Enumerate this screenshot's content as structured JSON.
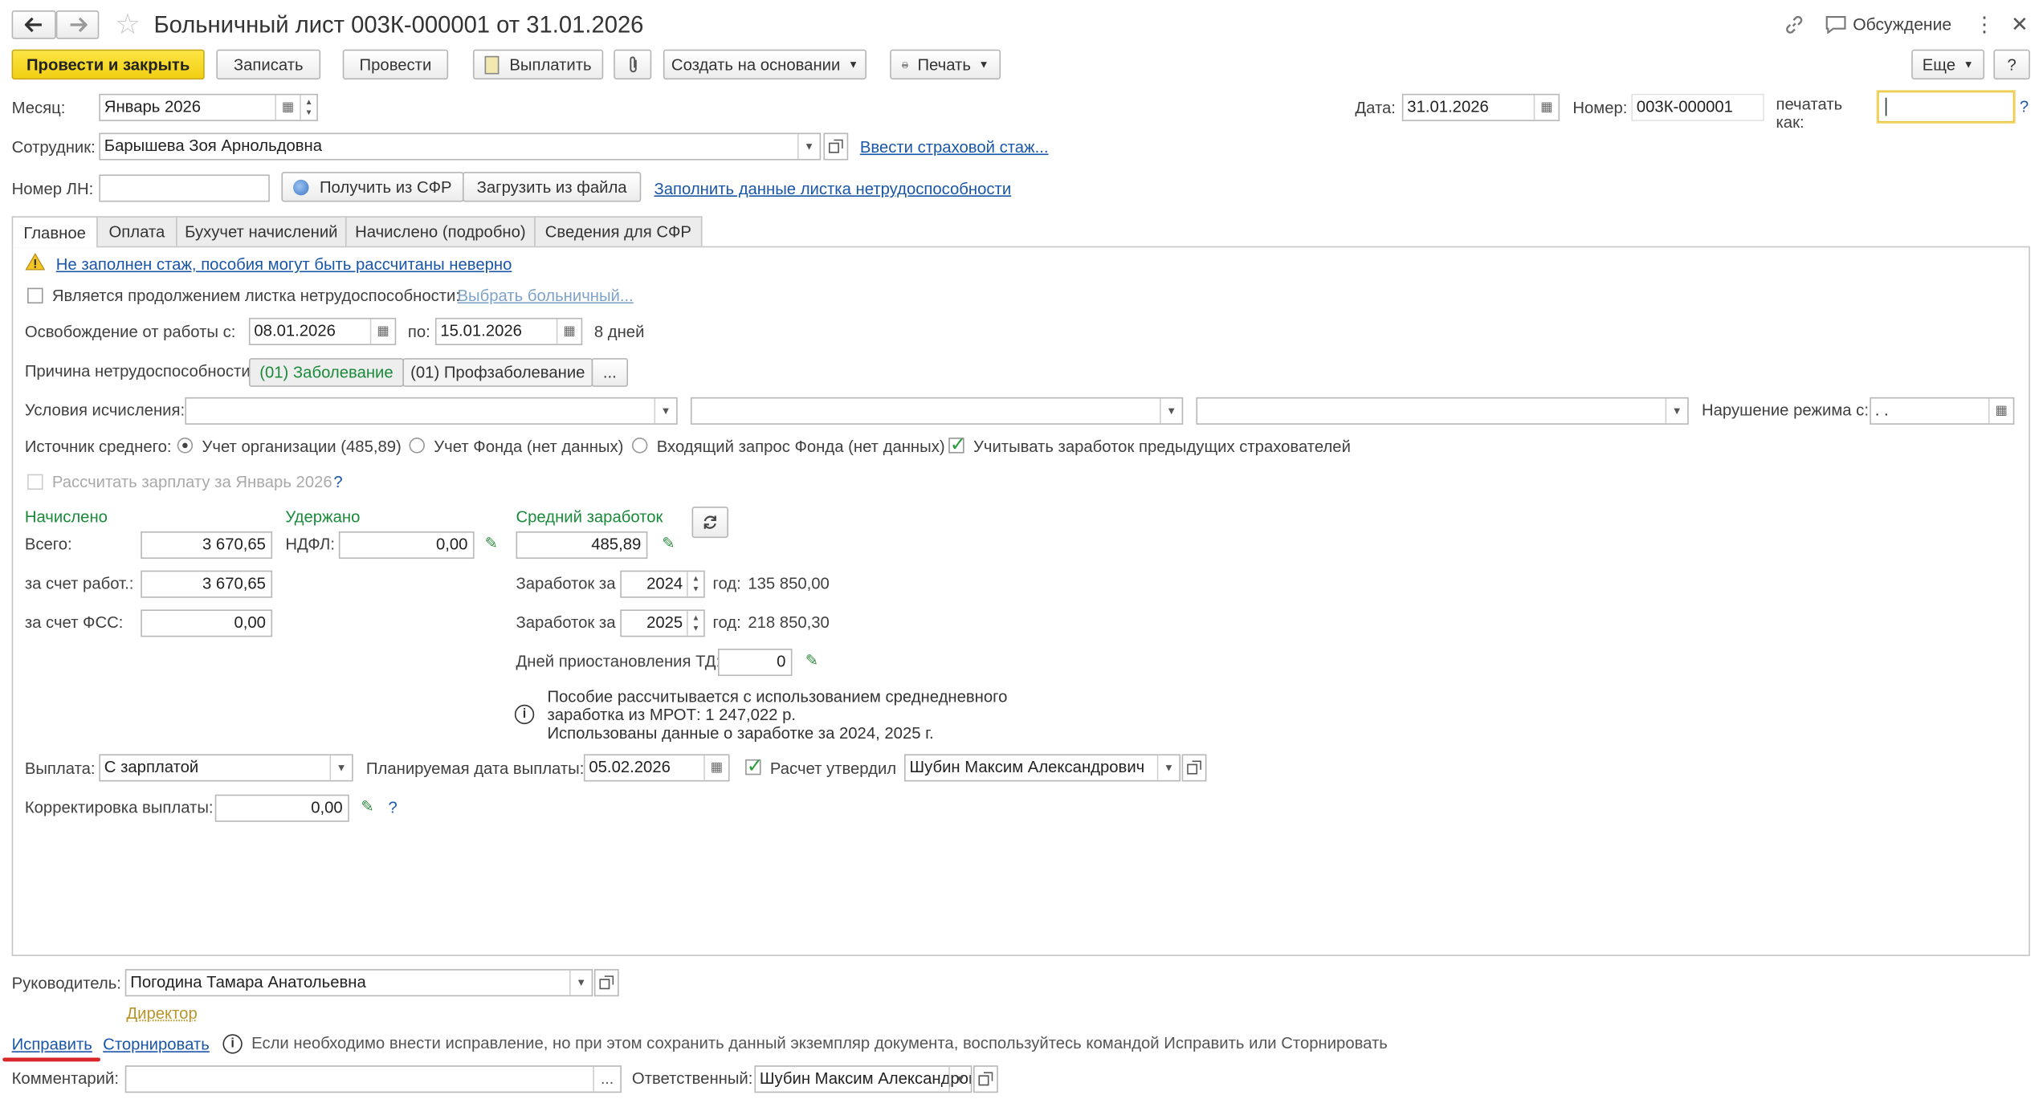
{
  "window": {
    "title": "Больничный лист 003К-000001 от 31.01.2026",
    "discussion": "Обсуждение"
  },
  "toolbar": {
    "post_close": "Провести и закрыть",
    "save": "Записать",
    "post": "Провести",
    "pay": "Выплатить",
    "create_based": "Создать на основании",
    "print": "Печать",
    "more": "Еще",
    "help": "?"
  },
  "header": {
    "month_label": "Месяц:",
    "month_value": "Январь 2026",
    "date_label": "Дата:",
    "date_value": "31.01.2026",
    "number_label": "Номер:",
    "number_value": "003К-000001",
    "print_as_label_1": "печатать",
    "print_as_label_2": "как:",
    "print_as_value": "",
    "print_as_help": "?",
    "employee_label": "Сотрудник:",
    "employee_value": "Барышева Зоя Арнольдовна",
    "insurance_link": "Ввести страховой стаж...",
    "ln_label": "Номер ЛН:",
    "ln_value": "",
    "get_sfr": "Получить из СФР",
    "load_file": "Загрузить из файла",
    "fill_link": "Заполнить данные листка нетрудоспособности"
  },
  "tabs": [
    {
      "label": "Главное",
      "active": true
    },
    {
      "label": "Оплата"
    },
    {
      "label": "Бухучет начислений"
    },
    {
      "label": "Начислено (подробно)"
    },
    {
      "label": "Сведения для СФР"
    }
  ],
  "main": {
    "warning_link": "Не заполнен стаж, пособия могут быть рассчитаны неверно",
    "continuation_label": "Является продолжением листка нетрудоспособности:",
    "choose_link": "Выбрать больничный...",
    "release_label": "Освобождение от работы с:",
    "release_from": "08.01.2026",
    "release_to_label": "по:",
    "release_to": "15.01.2026",
    "days": "8 дней",
    "reason_label": "Причина нетрудоспособности:",
    "reason_1": "(01) Заболевание",
    "reason_2": "(01) Профзаболевание",
    "reason_more": "...",
    "conditions_label": "Условия исчисления:",
    "violation_label": "Нарушение режима с:",
    "violation_value": " .  .",
    "avg_source_label": "Источник среднего:",
    "avg_opt_1": "Учет организации (485,89)",
    "avg_opt_2": "Учет Фонда (нет данных)",
    "avg_opt_3": "Входящий запрос Фонда (нет данных)",
    "prev_insurers": "Учитывать заработок предыдущих страхователей",
    "calc_salary": "Рассчитать зарплату за Январь 2026",
    "calc_help": "?",
    "accrued_header": "Начислено",
    "withheld_header": "Удержано",
    "avg_header": "Средний заработок",
    "total_label": "Всего:",
    "total_value": "3 670,65",
    "ndfl_label": "НДФЛ:",
    "ndfl_value": "0,00",
    "avg_value": "485,89",
    "employer_label": "за счет работ.:",
    "employer_value": "3 670,65",
    "fss_label": "за счет ФСС:",
    "fss_value": "0,00",
    "earn_label": "Заработок за",
    "year1": "2024",
    "year1_suffix": "год:",
    "earn1": "135 850,00",
    "year2": "2025",
    "year2_suffix": "год:",
    "earn2": "218 850,30",
    "suspend_label": "Дней приостановления ТД:",
    "suspend_value": "0",
    "info_1": "Пособие рассчитывается с использованием среднедневного",
    "info_2": "заработка из МРОТ: 1 247,022 р.",
    "info_3": "Использованы данные о заработке за  2024,  2025 г.",
    "payout_label": "Выплата:",
    "payout_value": "С зарплатой",
    "plan_date_label": "Планируемая дата выплаты:",
    "plan_date_value": "05.02.2026",
    "approved_label": "Расчет утвердил",
    "approved_value": "Шубин Максим Александрович",
    "correction_label": "Корректировка выплаты:",
    "correction_value": "0,00",
    "correction_help": "?"
  },
  "footer": {
    "head_label": "Руководитель:",
    "head_value": "Погодина Тамара Анатольевна",
    "director_link": "Директор",
    "fix_link": "Исправить",
    "reverse_link": "Сторнировать",
    "info_text": "Если необходимо внести исправление, но при этом сохранить данный экземпляр документа, воспользуйтесь командой Исправить или Сторнировать",
    "comment_label": "Комментарий:",
    "comment_value": "",
    "comment_more": "...",
    "responsible_label": "Ответственный:",
    "responsible_value": "Шубин Максим Александрович"
  },
  "colors": {
    "primary_button": "#f5d523",
    "link": "#1a56a8",
    "green_text": "#1a8a3a",
    "annotation_underline": "#d9262a"
  }
}
